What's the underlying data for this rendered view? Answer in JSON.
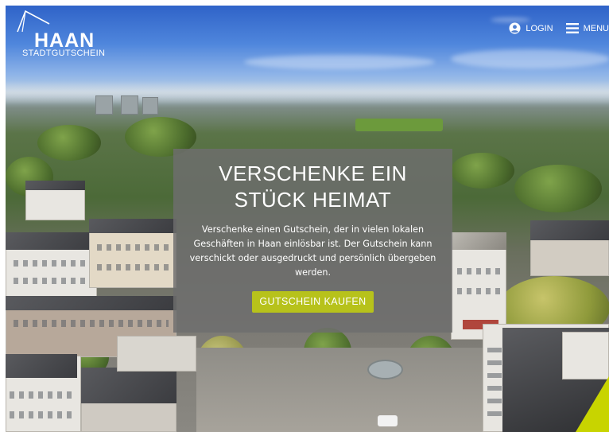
{
  "logo": {
    "name": "HAAN",
    "subtitle": "STADTGUTSCHEIN"
  },
  "nav": {
    "login_label": "LOGIN",
    "menu_label": "MENU"
  },
  "hero": {
    "title": "VERSCHENKE EIN STÜCK HEIMAT",
    "text": "Verschenke einen Gutschein, der in vielen lokalen Geschäften in Haan einlösbar ist. Der Gutschein kann verschickt oder ausgedruckt und persönlich übergeben werden.",
    "cta_label": "GUTSCHEIN KAUFEN"
  },
  "icons": {
    "login": "user-circle-icon",
    "menu": "hamburger-icon",
    "logo": "haan-logo-mark-icon"
  },
  "colors": {
    "accent": "#b7c21b",
    "card_overlay": "#6e6e6e",
    "text": "#ffffff"
  }
}
